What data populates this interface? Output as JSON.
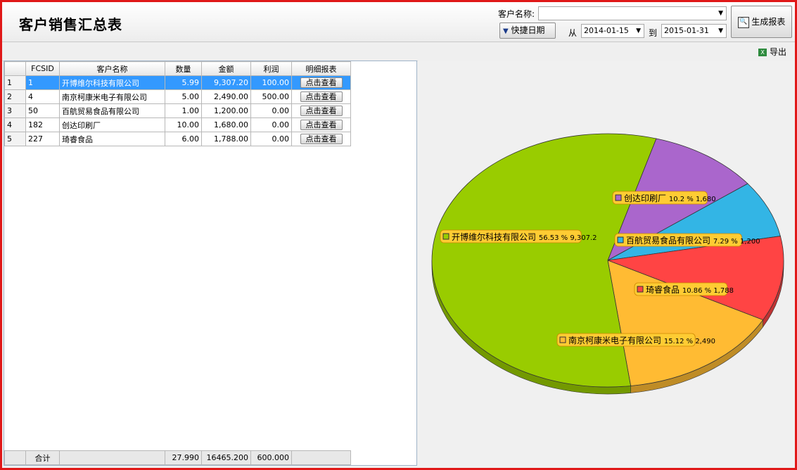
{
  "header": {
    "title": "客户销售汇总表",
    "customer_label": "客户名称:",
    "customer_value": "",
    "quick_date_label": "快捷日期",
    "from_label": "从",
    "from_date": "2014-01-15",
    "to_label": "到",
    "to_date": "2015-01-31",
    "generate_label": "生成报表"
  },
  "toolbar": {
    "export_label": "导出"
  },
  "table": {
    "columns": [
      "FCSID",
      "客户名称",
      "数量",
      "金额",
      "利润",
      "明细报表"
    ],
    "rows": [
      {
        "rn": "1",
        "id": "1",
        "name": "开博维尔科技有限公司",
        "qty": "5.99",
        "amount": "9,307.20",
        "profit": "100.00",
        "btn": "点击查看"
      },
      {
        "rn": "2",
        "id": "4",
        "name": "南京柯康米电子有限公司",
        "qty": "5.00",
        "amount": "2,490.00",
        "profit": "500.00",
        "btn": "点击查看"
      },
      {
        "rn": "3",
        "id": "50",
        "name": "百航贸易食品有限公司",
        "qty": "1.00",
        "amount": "1,200.00",
        "profit": "0.00",
        "btn": "点击查看"
      },
      {
        "rn": "4",
        "id": "182",
        "name": "创达印刷厂",
        "qty": "10.00",
        "amount": "1,680.00",
        "profit": "0.00",
        "btn": "点击查看"
      },
      {
        "rn": "5",
        "id": "227",
        "name": "琦睿食品",
        "qty": "6.00",
        "amount": "1,788.00",
        "profit": "0.00",
        "btn": "点击查看"
      }
    ],
    "footer": {
      "label": "合计",
      "qty": "27.990",
      "amount": "16465.200",
      "profit": "600.000"
    }
  },
  "chart_data": {
    "type": "pie",
    "slices": [
      {
        "label": "开博维尔科技有限公司",
        "percent": 56.53,
        "value": 9307.2,
        "display": "56.53 % 9,307.2",
        "color": "#99cc00"
      },
      {
        "label": "创达印刷厂",
        "percent": 10.2,
        "value": 1680,
        "display": "10.2 % 1,680",
        "color": "#aa66cc"
      },
      {
        "label": "百航贸易食品有限公司",
        "percent": 7.29,
        "value": 1200,
        "display": "7.29 % 1,200",
        "color": "#33b5e5"
      },
      {
        "label": "琦睿食品",
        "percent": 10.86,
        "value": 1788,
        "display": "10.86 % 1,788",
        "color": "#ff4444"
      },
      {
        "label": "南京柯康米电子有限公司",
        "percent": 15.12,
        "value": 2490,
        "display": "15.12 % 2,490",
        "color": "#ffbb33"
      }
    ]
  }
}
